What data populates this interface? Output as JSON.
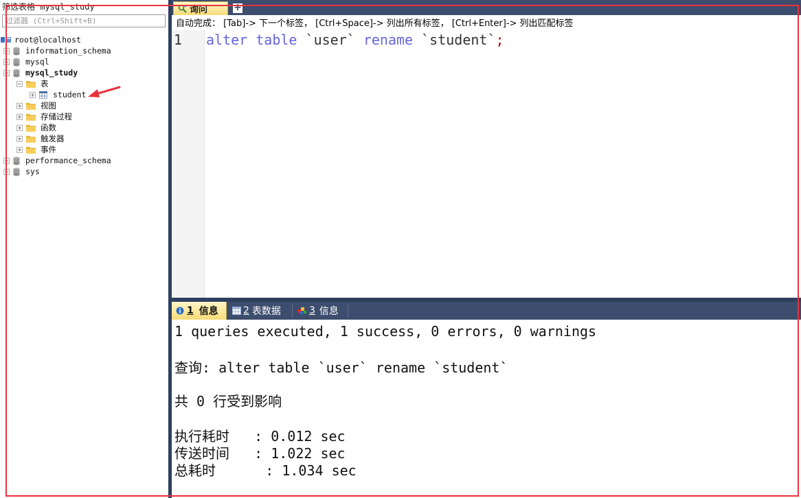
{
  "sidebar": {
    "filter_title": "筛选表格 mysql_study",
    "filter_placeholder": "过滤器 (Ctrl+Shift+B)",
    "server": "root@localhost",
    "databases": [
      "information_schema",
      "mysql",
      "mysql_study",
      "performance_schema",
      "sys"
    ],
    "mysql_study_children": {
      "tables_folder": "表",
      "table_student": "student",
      "views": "视图",
      "procedures": "存储过程",
      "functions": "函数",
      "triggers": "触发器",
      "events": "事件"
    },
    "expand_plus": "+",
    "expand_minus": "−"
  },
  "editor": {
    "tab_label": "询问",
    "add_tab": "+",
    "autocomplete_hint": "自动完成：  [Tab]-> 下一个标签，  [Ctrl+Space]-> 列出所有标签，  [Ctrl+Enter]-> 列出匹配标签",
    "line_number": "1",
    "code": {
      "kw1": "alter",
      "kw2": "table",
      "tbl_old": "`user`",
      "kw3": "rename",
      "tbl_new": "`student`",
      "semicolon": ";"
    }
  },
  "result_tabs": [
    {
      "num": "1",
      "label": "信息"
    },
    {
      "num": "2",
      "label": "表数据"
    },
    {
      "num": "3",
      "label": "信息"
    }
  ],
  "messages": {
    "summary": "1 queries executed, 1 success, 0 errors, 0 warnings",
    "query": "查询: alter table `user` rename `student`",
    "affected": "共 0 行受到影响",
    "exec_time": "执行耗时   : 0.012 sec",
    "transfer_time": "传送时间   : 1.022 sec",
    "total_time": "总耗时      : 1.034 sec"
  },
  "colors": {
    "keyword": "#6464dc",
    "panel_dark": "#2e3f5e",
    "tab_active": "#f6dc78",
    "annotation": "#e8323c"
  }
}
